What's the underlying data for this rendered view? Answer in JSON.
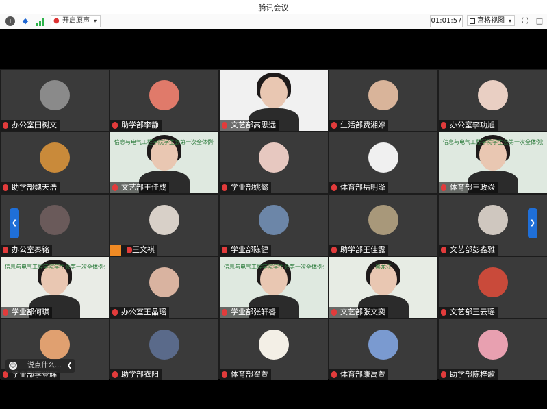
{
  "window": {
    "title": "腾讯会议"
  },
  "toolbar": {
    "info_icon": "i",
    "noise_label": "开启原声",
    "timer": "01:01:57",
    "view_label": "宫格视图"
  },
  "chat": {
    "placeholder": "说点什么..."
  },
  "participants": [
    {
      "name": "办公室田树文",
      "type": "avatar",
      "color": "#8a8a8a"
    },
    {
      "name": "助学部李静",
      "type": "avatar",
      "color": "#e07a6a"
    },
    {
      "name": "文艺部高思远",
      "type": "video",
      "bg": "#f1f1f1"
    },
    {
      "name": "生活部费湘婷",
      "type": "avatar",
      "color": "#d9b49a"
    },
    {
      "name": "办公室李功旭",
      "type": "avatar",
      "color": "#e9cfc3"
    },
    {
      "name": "助学部魏天浩",
      "type": "avatar",
      "color": "#c98a3a"
    },
    {
      "name": "文艺部王佳成",
      "type": "video",
      "bg": "#dfe9e0",
      "banner": "信息与电气工程学院学生会第一次全体例会"
    },
    {
      "name": "学业部姚懿",
      "type": "avatar",
      "color": "#e7c8c0"
    },
    {
      "name": "体育部岳明泽",
      "type": "avatar",
      "color": "#f0f0f0"
    },
    {
      "name": "体育部王政焱",
      "type": "video",
      "bg": "#dfe9e0",
      "banner": "信息与电气工程学院学生会第一次全体例会"
    },
    {
      "name": "办公室秦铭",
      "type": "avatar",
      "color": "#6a5a5a"
    },
    {
      "name": "王文祺",
      "type": "avatar",
      "color": "#d8d0c8",
      "orange": true
    },
    {
      "name": "学业部陈健",
      "type": "avatar",
      "color": "#6c86a8"
    },
    {
      "name": "助学部王佳露",
      "type": "avatar",
      "color": "#a8987a"
    },
    {
      "name": "文艺部彭鑫雅",
      "type": "avatar",
      "color": "#cfc7bf"
    },
    {
      "name": "学业部何琪",
      "type": "video",
      "bg": "#e9ece6",
      "banner": "信息与电气工程学院学生会第一次全体例会"
    },
    {
      "name": "办公室王晶瑶",
      "type": "avatar",
      "color": "#d9b3a0"
    },
    {
      "name": "学业部张轩睿",
      "type": "video",
      "bg": "#dfe9e0",
      "banner": "信息与电气工程学院学生会第一次全体例会"
    },
    {
      "name": "文艺部张文奕",
      "type": "video",
      "bg": "#e7ece4",
      "banner": "黑龙江"
    },
    {
      "name": "文艺部王云瑶",
      "type": "avatar",
      "color": "#c94a3a"
    },
    {
      "name": "学业部李登辉",
      "type": "avatar",
      "color": "#e0a070"
    },
    {
      "name": "助学部衣阳",
      "type": "avatar",
      "color": "#5a6a8a"
    },
    {
      "name": "体育部翟萱",
      "type": "avatar",
      "color": "#f3efe6"
    },
    {
      "name": "体育部康禹萱",
      "type": "avatar",
      "color": "#7a9ad0"
    },
    {
      "name": "助学部陈梓歌",
      "type": "avatar",
      "color": "#e8a0b0"
    }
  ]
}
